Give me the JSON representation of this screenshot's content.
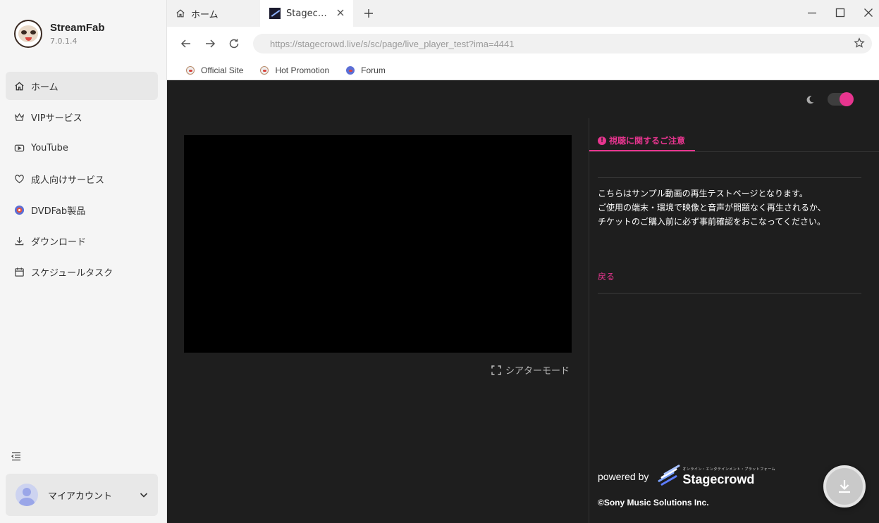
{
  "app": {
    "name": "StreamFab",
    "version": "7.0.1.4"
  },
  "sidebar": {
    "items": [
      {
        "label": "ホーム",
        "icon": "home-icon"
      },
      {
        "label": "VIPサービス",
        "icon": "crown-icon"
      },
      {
        "label": "YouTube",
        "icon": "youtube-icon"
      },
      {
        "label": "成人向けサービス",
        "icon": "heart-icon"
      },
      {
        "label": "DVDFab製品",
        "icon": "dvdfab-icon"
      },
      {
        "label": "ダウンロード",
        "icon": "download-icon"
      },
      {
        "label": "スケジュールタスク",
        "icon": "calendar-icon"
      }
    ],
    "account_label": "マイアカウント"
  },
  "tabs": [
    {
      "label": "ホーム"
    },
    {
      "label": "Stagec…"
    }
  ],
  "toolbar": {
    "url": "https://stagecrowd.live/s/sc/page/live_player_test?ima=4441"
  },
  "bookmarks": [
    {
      "label": "Official Site"
    },
    {
      "label": "Hot Promotion"
    },
    {
      "label": "Forum"
    }
  ],
  "page": {
    "theater_label": "シアターモード",
    "panel_tab": "視聴に関するご注意",
    "notice_lines": [
      "こちらはサンプル動画の再生テストページとなります。",
      "ご使用の端末・環境で映像と音声が問題なく再生されるか、",
      "チケットのご購入前に必ず事前確認をおこなってください。"
    ],
    "back_link": "戻る",
    "powered_by": "powered by",
    "brand_sub": "オンライン・エンタテインメント・プラットフォーム",
    "brand_name": "Stagecrowd",
    "copyright": "©Sony Music Solutions Inc."
  },
  "colors": {
    "accent": "#e7358f",
    "page_bg": "#1e1e1e",
    "sidebar_bg": "#f5f5f5"
  }
}
